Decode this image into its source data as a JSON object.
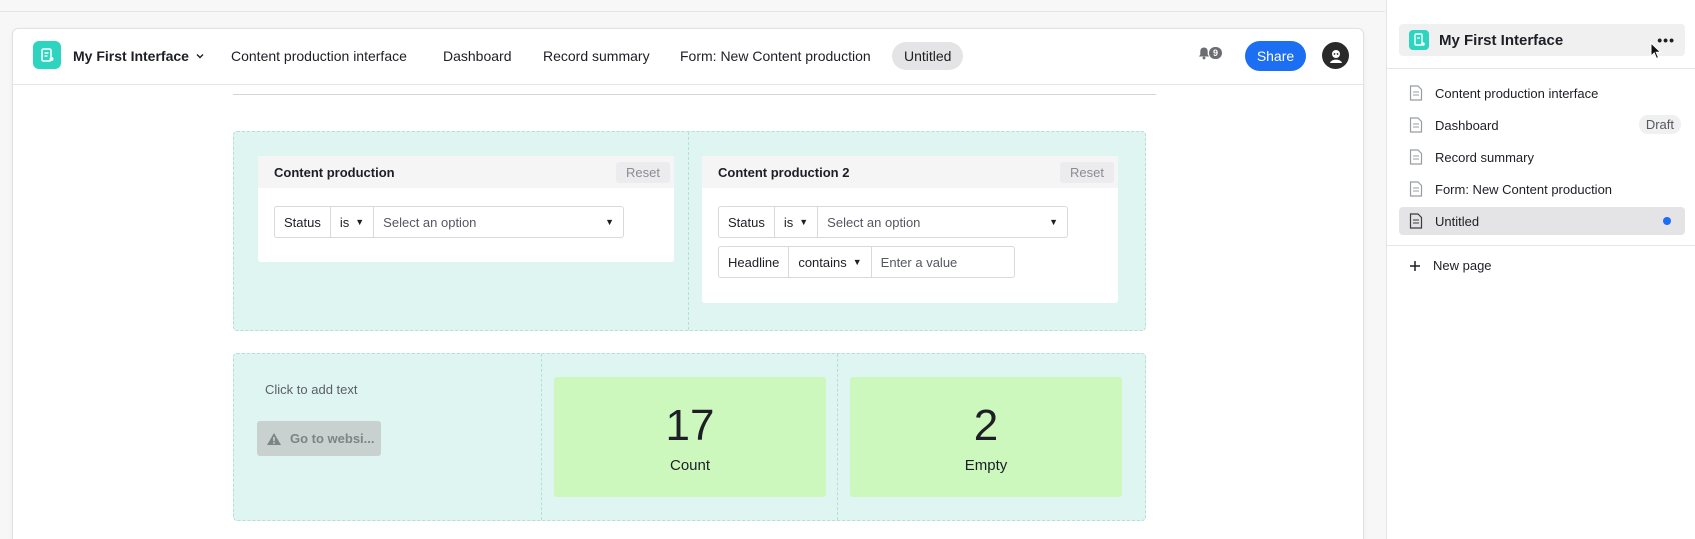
{
  "app": {
    "name": "My First Interface"
  },
  "navbar": {
    "tabs": [
      {
        "label": "Content production interface"
      },
      {
        "label": "Dashboard"
      },
      {
        "label": "Record summary"
      },
      {
        "label": "Form: New Content production"
      },
      {
        "label": "Untitled",
        "active": true
      }
    ],
    "notification_count": "9",
    "share_label": "Share"
  },
  "filters": [
    {
      "title": "Content production",
      "reset_label": "Reset",
      "rows": [
        {
          "field": "Status",
          "operator": "is",
          "value_placeholder": "Select an option"
        }
      ]
    },
    {
      "title": "Content production 2",
      "reset_label": "Reset",
      "rows": [
        {
          "field": "Status",
          "operator": "is",
          "value_placeholder": "Select an option"
        },
        {
          "field": "Headline",
          "operator": "contains",
          "value_placeholder": "Enter a value"
        }
      ]
    }
  ],
  "text_block": {
    "placeholder": "Click to add text"
  },
  "button_block": {
    "label": "Go to websi...",
    "icon": "warning-icon"
  },
  "stats": [
    {
      "value": "17",
      "label": "Count"
    },
    {
      "value": "2",
      "label": "Empty"
    }
  ],
  "sidebar": {
    "title": "My First Interface",
    "more_icon": "more-icon",
    "pages": [
      {
        "label": "Content production interface"
      },
      {
        "label": "Dashboard",
        "badge": "Draft"
      },
      {
        "label": "Record summary"
      },
      {
        "label": "Form: New Content production"
      },
      {
        "label": "Untitled",
        "active": true,
        "unsaved_dot": true
      }
    ],
    "new_page_label": "New page"
  },
  "colors": {
    "accent": "#1c6ef2",
    "app_icon": "#2dd4bf",
    "section_bg": "#dff5f2",
    "stat_bg": "#ccf7bd"
  }
}
